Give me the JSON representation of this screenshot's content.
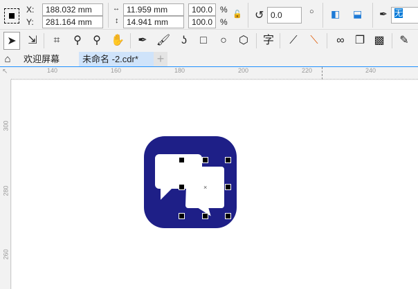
{
  "propbar": {
    "x_label": "X:",
    "y_label": "Y:",
    "x_value": "188.032 mm",
    "y_value": "281.164 mm",
    "width_value": "11.959 mm",
    "height_value": "14.941 mm",
    "scale_x": "100.0",
    "scale_y": "100.0",
    "percent": "%",
    "rotation": "0.0",
    "outline": "无"
  },
  "tabs": [
    {
      "label": "欢迎屏幕"
    },
    {
      "label": "未命名 -2.cdr*"
    }
  ],
  "add_tab": "+",
  "ruler_h": [
    "140",
    "160",
    "180",
    "200",
    "220",
    "240"
  ],
  "ruler_v": [
    "300",
    "280",
    "260"
  ],
  "toolbox": {
    "text_tool": "字"
  },
  "colors": {
    "icon_bg": "#1e1f87",
    "tab_active": "#cfe3fa",
    "accent": "#1e90ff"
  }
}
